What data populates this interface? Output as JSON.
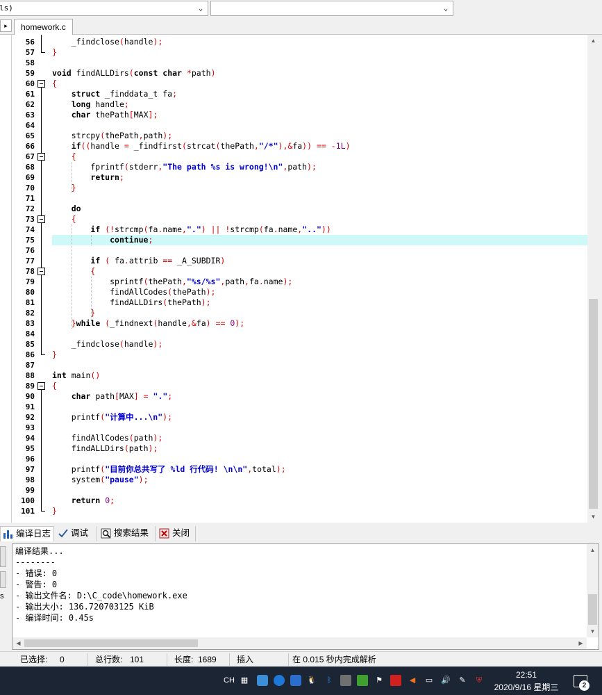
{
  "toolbar": {
    "combo_left_value": "ls)",
    "combo_right_value": ""
  },
  "tabs": {
    "nav_arrow": "▸",
    "file_tab": "homework.c"
  },
  "editor": {
    "highlight_line": 75,
    "lines": [
      {
        "n": "56",
        "code": "    <span class=\"fn\">_findclose</span><span class=\"op\">(</span>handle<span class=\"op\">);</span>"
      },
      {
        "n": "57",
        "code": "<span class=\"op\">}</span>"
      },
      {
        "n": "58",
        "code": ""
      },
      {
        "n": "59",
        "code": "<span class=\"kw\">void</span> findALLDirs<span class=\"op\">(</span><span class=\"kw\">const char</span> <span class=\"op\">*</span>path<span class=\"op\">)</span>"
      },
      {
        "n": "60",
        "code": "<span class=\"op\">{</span>"
      },
      {
        "n": "61",
        "code": "    <span class=\"kw\">struct</span> _finddata_t fa<span class=\"op\">;</span>"
      },
      {
        "n": "62",
        "code": "    <span class=\"kw\">long</span> handle<span class=\"op\">;</span>"
      },
      {
        "n": "63",
        "code": "    <span class=\"kw\">char</span> thePath<span class=\"op\">[</span>MAX<span class=\"op\">];</span>"
      },
      {
        "n": "64",
        "code": ""
      },
      {
        "n": "65",
        "code": "    strcpy<span class=\"op\">(</span>thePath<span class=\"op\">,</span>path<span class=\"op\">);</span>"
      },
      {
        "n": "66",
        "code": "    <span class=\"kw\">if</span><span class=\"op\">((</span>handle <span class=\"op\">=</span> _findfirst<span class=\"op\">(</span>strcat<span class=\"op\">(</span>thePath<span class=\"op\">,</span><span class=\"st\">\"/*\"</span><span class=\"op\">),&amp;</span>fa<span class=\"op\">))</span> <span class=\"op\">==</span> <span class=\"op\">-</span><span class=\"nm\">1L</span><span class=\"op\">)</span>"
      },
      {
        "n": "67",
        "code": "    <span class=\"op\">{</span>"
      },
      {
        "n": "68",
        "code": "        fprintf<span class=\"op\">(</span>stderr<span class=\"op\">,</span><span class=\"st\">\"The path %s is wrong!\\n\"</span><span class=\"op\">,</span>path<span class=\"op\">);</span>"
      },
      {
        "n": "69",
        "code": "        <span class=\"kw\">return</span><span class=\"op\">;</span>"
      },
      {
        "n": "70",
        "code": "    <span class=\"op\">}</span>"
      },
      {
        "n": "71",
        "code": ""
      },
      {
        "n": "72",
        "code": "    <span class=\"kw\">do</span>"
      },
      {
        "n": "73",
        "code": "    <span class=\"op\">{</span>"
      },
      {
        "n": "74",
        "code": "        <span class=\"kw\">if</span> <span class=\"op\">(!</span>strcmp<span class=\"op\">(</span>fa<span class=\"op\">.</span>name<span class=\"op\">,</span><span class=\"st\">\".\"</span><span class=\"op\">) || !</span>strcmp<span class=\"op\">(</span>fa<span class=\"op\">.</span>name<span class=\"op\">,</span><span class=\"st\">\"..\"</span><span class=\"op\">))</span>"
      },
      {
        "n": "75",
        "code": "            <span class=\"kw\">continue</span><span class=\"op\">;</span>"
      },
      {
        "n": "76",
        "code": ""
      },
      {
        "n": "77",
        "code": "        <span class=\"kw\">if</span> <span class=\"op\">(</span> fa<span class=\"op\">.</span>attrib <span class=\"op\">==</span> _A_SUBDIR<span class=\"op\">)</span>"
      },
      {
        "n": "78",
        "code": "        <span class=\"op\">{</span>"
      },
      {
        "n": "79",
        "code": "            sprintf<span class=\"op\">(</span>thePath<span class=\"op\">,</span><span class=\"st\">\"%s/%s\"</span><span class=\"op\">,</span>path<span class=\"op\">,</span>fa<span class=\"op\">.</span>name<span class=\"op\">);</span>"
      },
      {
        "n": "80",
        "code": "            findAllCodes<span class=\"op\">(</span>thePath<span class=\"op\">);</span>"
      },
      {
        "n": "81",
        "code": "            findALLDirs<span class=\"op\">(</span>thePath<span class=\"op\">);</span>"
      },
      {
        "n": "82",
        "code": "        <span class=\"op\">}</span>"
      },
      {
        "n": "83",
        "code": "    <span class=\"op\">}</span><span class=\"kw\">while</span> <span class=\"op\">(</span>_findnext<span class=\"op\">(</span>handle<span class=\"op\">,&amp;</span>fa<span class=\"op\">)</span> <span class=\"op\">==</span> <span class=\"nm\">0</span><span class=\"op\">);</span>"
      },
      {
        "n": "84",
        "code": ""
      },
      {
        "n": "85",
        "code": "    _findclose<span class=\"op\">(</span>handle<span class=\"op\">);</span>"
      },
      {
        "n": "86",
        "code": "<span class=\"op\">}</span>"
      },
      {
        "n": "87",
        "code": ""
      },
      {
        "n": "88",
        "code": "<span class=\"kw\">int</span> main<span class=\"op\">()</span>"
      },
      {
        "n": "89",
        "code": "<span class=\"op\">{</span>"
      },
      {
        "n": "90",
        "code": "    <span class=\"kw\">char</span> path<span class=\"op\">[</span>MAX<span class=\"op\">] =</span> <span class=\"st\">\".\"</span><span class=\"op\">;</span>"
      },
      {
        "n": "91",
        "code": ""
      },
      {
        "n": "92",
        "code": "    printf<span class=\"op\">(</span><span class=\"st\">\"计算中...\\n\"</span><span class=\"op\">);</span>"
      },
      {
        "n": "93",
        "code": ""
      },
      {
        "n": "94",
        "code": "    findAllCodes<span class=\"op\">(</span>path<span class=\"op\">);</span>"
      },
      {
        "n": "95",
        "code": "    findALLDirs<span class=\"op\">(</span>path<span class=\"op\">);</span>"
      },
      {
        "n": "96",
        "code": ""
      },
      {
        "n": "97",
        "code": "    printf<span class=\"op\">(</span><span class=\"st\">\"目前你总共写了 %ld 行代码! \\n\\n\"</span><span class=\"op\">,</span>total<span class=\"op\">);</span>"
      },
      {
        "n": "98",
        "code": "    system<span class=\"op\">(</span><span class=\"st\">\"pause\"</span><span class=\"op\">);</span>"
      },
      {
        "n": "99",
        "code": ""
      },
      {
        "n": "100",
        "code": "    <span class=\"kw\">return</span> <span class=\"nm\">0</span><span class=\"op\">;</span>"
      },
      {
        "n": "101",
        "code": "<span class=\"op\">}</span>"
      }
    ],
    "fold_lines": [
      "60",
      "67",
      "73",
      "78",
      "89"
    ]
  },
  "bottom_tabs": [
    {
      "label": "编译日志",
      "icon": "bar-chart-icon"
    },
    {
      "label": "调试",
      "icon": "check-icon"
    },
    {
      "label": "搜索结果",
      "icon": "search-icon"
    },
    {
      "label": "关闭",
      "icon": "close-icon"
    }
  ],
  "output": {
    "lines": [
      "编译结果...",
      "--------",
      "- 错误: 0",
      "- 警告: 0",
      "- 输出文件名: D:\\C_code\\homework.exe",
      "- 输出大小: 136.720703125 KiB",
      "- 编译时间: 0.45s"
    ]
  },
  "left_side": {
    "label": "s"
  },
  "status": {
    "selected_label": "已选择:",
    "selected_value": "0",
    "total_lines_label": "总行数:",
    "total_lines_value": "101",
    "length_label": "长度:",
    "length_value": "1689",
    "mode": "插入",
    "parse_msg": "在 0.015 秒内完成解析"
  },
  "taskbar": {
    "lang": "CH",
    "time": "22:51",
    "date": "2020/9/16 星期三",
    "notif_count": "2",
    "colors": {
      "bg": "#1c2533"
    }
  },
  "colors": {
    "keyword": "#000000",
    "operator": "#d00000",
    "string": "#0000d0",
    "number": "#7f007f",
    "highlight": "#cff8f8"
  }
}
